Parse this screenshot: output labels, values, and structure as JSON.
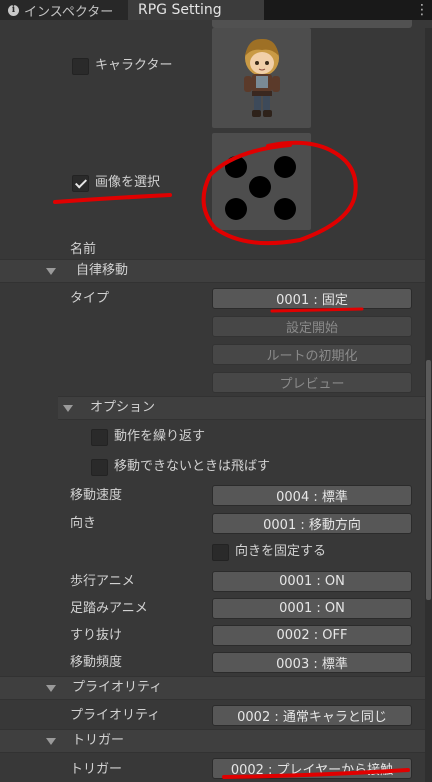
{
  "tabs": {
    "inspector": "インスペクター",
    "rpg_setting": "RPG Setting"
  },
  "graphic": {
    "character_label": "キャラクター",
    "character_checked": false,
    "image_label": "画像を選択",
    "image_checked": true
  },
  "name_label": "名前",
  "autonomous": {
    "header": "自律移動",
    "type_label": "タイプ",
    "type_value": "0001 : 固定",
    "start_settings": "設定開始",
    "init_route": "ルートの初期化",
    "preview": "プレビュー"
  },
  "options": {
    "header": "オプション",
    "repeat_label": "動作を繰り返す",
    "skip_label": "移動できないときは飛ばす"
  },
  "movement": {
    "speed_label": "移動速度",
    "speed_value": "0004 : 標準",
    "direction_label": "向き",
    "direction_value": "0001 : 移動方向",
    "fix_direction_label": "向きを固定する",
    "walk_anim_label": "歩行アニメ",
    "walk_anim_value": "0001 : ON",
    "step_anim_label": "足踏みアニメ",
    "step_anim_value": "0001 : ON",
    "pass_through_label": "すり抜け",
    "pass_through_value": "0002 : OFF",
    "frequency_label": "移動頻度",
    "frequency_value": "0003 : 標準"
  },
  "priority": {
    "header": "プライオリティ",
    "label": "プライオリティ",
    "value": "0002 : 通常キャラと同じ"
  },
  "trigger": {
    "header": "トリガー",
    "label": "トリガー",
    "value": "0002 : プレイヤーから接触"
  },
  "colors": {
    "annotation": "#e00000",
    "panel": "#383838",
    "button": "#575757"
  }
}
